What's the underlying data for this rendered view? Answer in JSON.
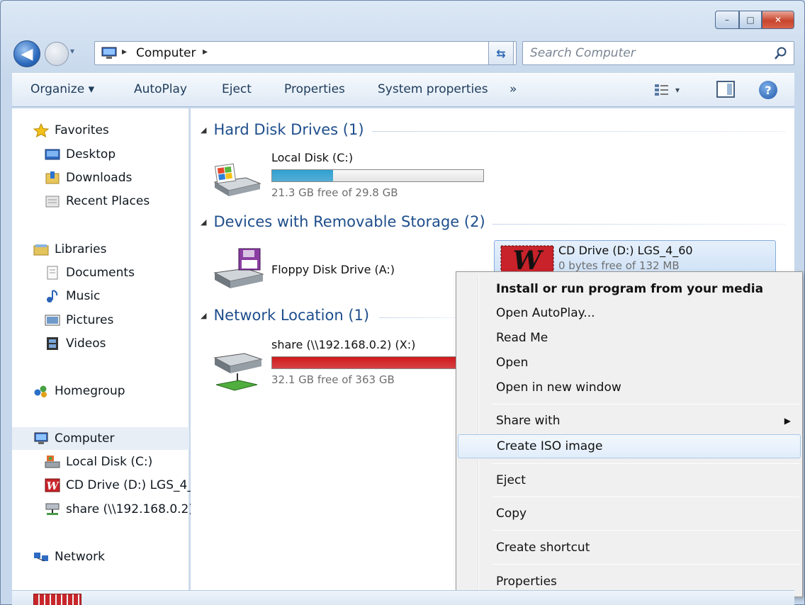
{
  "window": {
    "caption": {
      "minimize": "–",
      "maximize": "□",
      "close": "✕"
    }
  },
  "navigation": {
    "address": {
      "segment": "Computer"
    },
    "search": {
      "placeholder": "Search Computer"
    }
  },
  "command_bar": {
    "organize": "Organize ▾",
    "autoplay": "AutoPlay",
    "eject": "Eject",
    "properties": "Properties",
    "system_properties": "System properties",
    "more": "»"
  },
  "nav_pane": {
    "favorites": "Favorites",
    "desktop": "Desktop",
    "downloads": "Downloads",
    "recent_places": "Recent Places",
    "libraries": "Libraries",
    "documents": "Documents",
    "music": "Music",
    "pictures": "Pictures",
    "videos": "Videos",
    "homegroup": "Homegroup",
    "computer": "Computer",
    "local_disk": "Local Disk (C:)",
    "cd_drive": "CD Drive (D:) LGS_4_",
    "share": "share (\\\\192.168.0.2)",
    "network": "Network"
  },
  "content": {
    "groups": {
      "hard_disk": "Hard Disk Drives (1)",
      "removable": "Devices with Removable Storage (2)",
      "network": "Network Location (1)"
    },
    "drives": {
      "local_c": {
        "name": "Local Disk (C:)",
        "free": "21.3 GB free of 29.8 GB",
        "used_fraction": 0.29,
        "bar_color": "#2f9fd0"
      },
      "floppy": {
        "name": "Floppy Disk Drive (A:)"
      },
      "cd": {
        "name": "CD Drive (D:) LGS_4_60",
        "free": "0 bytes free of 132 MB"
      },
      "share": {
        "name": "share (\\\\192.168.0.2) (X:)",
        "free": "32.1 GB free of 363 GB",
        "used_fraction": 0.91,
        "bar_color": "#d0191c"
      }
    }
  },
  "context_menu": {
    "install": "Install or run program from your media",
    "open_autoplay": "Open AutoPlay...",
    "read_me": "Read Me",
    "open": "Open",
    "open_new_window": "Open in new window",
    "share_with": "Share with",
    "create_iso": "Create ISO image",
    "eject": "Eject",
    "copy": "Copy",
    "create_shortcut": "Create shortcut",
    "properties": "Properties"
  }
}
